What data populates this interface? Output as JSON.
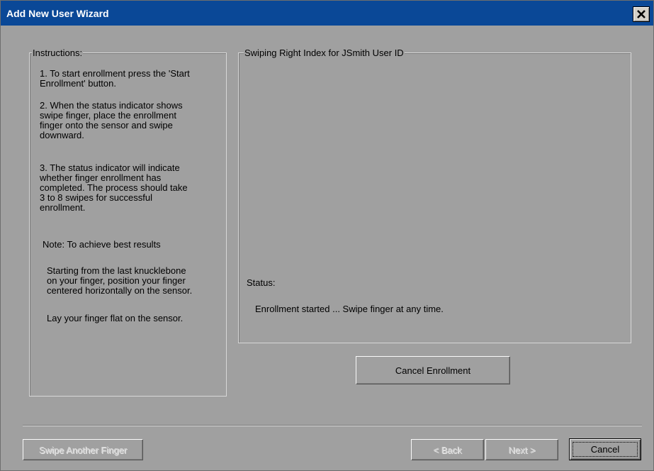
{
  "window": {
    "title": "Add New User Wizard"
  },
  "instructions": {
    "legend": "Instructions:",
    "step1": [
      "1. To start enrollment press the 'Start",
      "Enrollment' button."
    ],
    "step2": [
      "2. When the status indicator shows",
      "swipe finger, place the enrollment",
      "finger onto the sensor and swipe",
      "downward."
    ],
    "step3": [
      "3. The status indicator will indicate",
      "whether finger enrollment has",
      "completed.  The process should take",
      "3 to 8 swipes for successful",
      "enrollment."
    ],
    "note": "Note: To achieve best results",
    "tip1": [
      "Starting from the last knucklebone",
      "on your finger, position your finger",
      "centered horizontally on the sensor."
    ],
    "tip2": "Lay your finger flat on the sensor."
  },
  "swipe_panel": {
    "legend": "Swiping Right Index for JSmith User ID",
    "status_label": "Status:",
    "status_text": "Enrollment started ... Swipe finger at any time."
  },
  "buttons": {
    "cancel_enrollment": "Cancel Enrollment",
    "swipe_another": "Swipe Another Finger",
    "back": "< Back",
    "next": "Next >",
    "cancel": "Cancel"
  },
  "icons": {
    "close": "close-icon"
  }
}
